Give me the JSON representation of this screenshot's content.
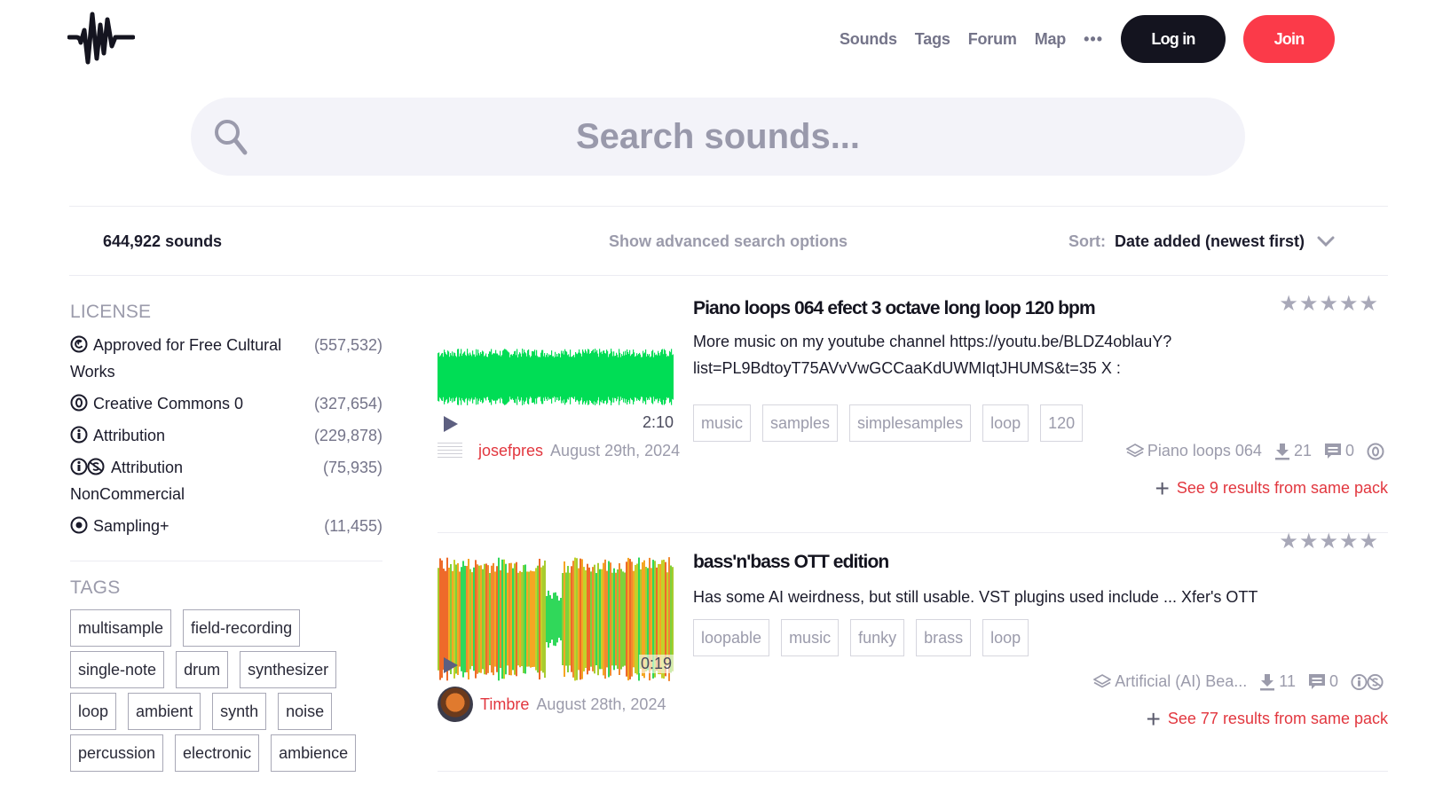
{
  "header": {
    "nav": [
      "Sounds",
      "Tags",
      "Forum",
      "Map"
    ],
    "more_label": "•••",
    "login_label": "Log in",
    "join_label": "Join",
    "colors": {
      "login_bg": "#14141f",
      "join_bg": "#fb3a49"
    }
  },
  "search": {
    "placeholder": "Search sounds...",
    "value": ""
  },
  "results_bar": {
    "count": "644,922 sounds",
    "advanced_label": "Show advanced search options",
    "sort_label": "Sort:",
    "sort_value": "Date added (newest first)"
  },
  "sidebar": {
    "license_title": "LICENSE",
    "licenses": [
      {
        "icon": "free-cultural-icon",
        "name": "Approved for Free Cultural Works",
        "count": "(557,532)"
      },
      {
        "icon": "cc0-icon",
        "name": "Creative Commons 0",
        "count": "(327,654)"
      },
      {
        "icon": "attribution-icon",
        "name": "Attribution",
        "count": "(229,878)"
      },
      {
        "icon": "attribution-noncommercial-icon",
        "name": "Attribution NonCommercial",
        "count": "(75,935)"
      },
      {
        "icon": "sampling-plus-icon",
        "name": "Sampling+",
        "count": "(11,455)"
      }
    ],
    "tags_title": "TAGS",
    "tags": [
      "multisample",
      "field-recording",
      "single-note",
      "drum",
      "synthesizer",
      "loop",
      "ambient",
      "synth",
      "noise",
      "percussion",
      "electronic",
      "ambience"
    ]
  },
  "results": [
    {
      "title": "Piano loops 064 efect 3 octave long loop 120 bpm",
      "description": "More music on my youtube channel https://youtu.be/BLDZ4oblauY? list=PL9BdtoyT75AVvVwGCCaaKdUWMIqtJHUMS&t=35 X :",
      "tags": [
        "music",
        "samples",
        "simplesamples",
        "loop",
        "120"
      ],
      "duration": "2:10",
      "rating": 0,
      "rating_max": 5,
      "author": "josefpres",
      "date": "August 29th, 2024",
      "pack": "Piano loops 064",
      "downloads": "21",
      "comments": "0",
      "license_icon": "cc0-icon",
      "more_from_pack": "See 9 results from same pack",
      "waveform_color": "#00dd55"
    },
    {
      "title": "bass'n'bass OTT edition",
      "description": "Has some AI weirdness, but still usable. VST plugins used include ... Xfer's OTT",
      "tags": [
        "loopable",
        "music",
        "funky",
        "brass",
        "loop"
      ],
      "duration": "0:19",
      "rating": 0,
      "rating_max": 5,
      "author": "Timbre",
      "date": "August 28th, 2024",
      "pack": "Artificial (AI) Bea...",
      "downloads": "11",
      "comments": "0",
      "license_icon": "attribution-noncommercial-icon",
      "more_from_pack": "See 77 results from same pack",
      "waveform_color": "#f08a30"
    }
  ],
  "stars_glyph": "★★★★★"
}
